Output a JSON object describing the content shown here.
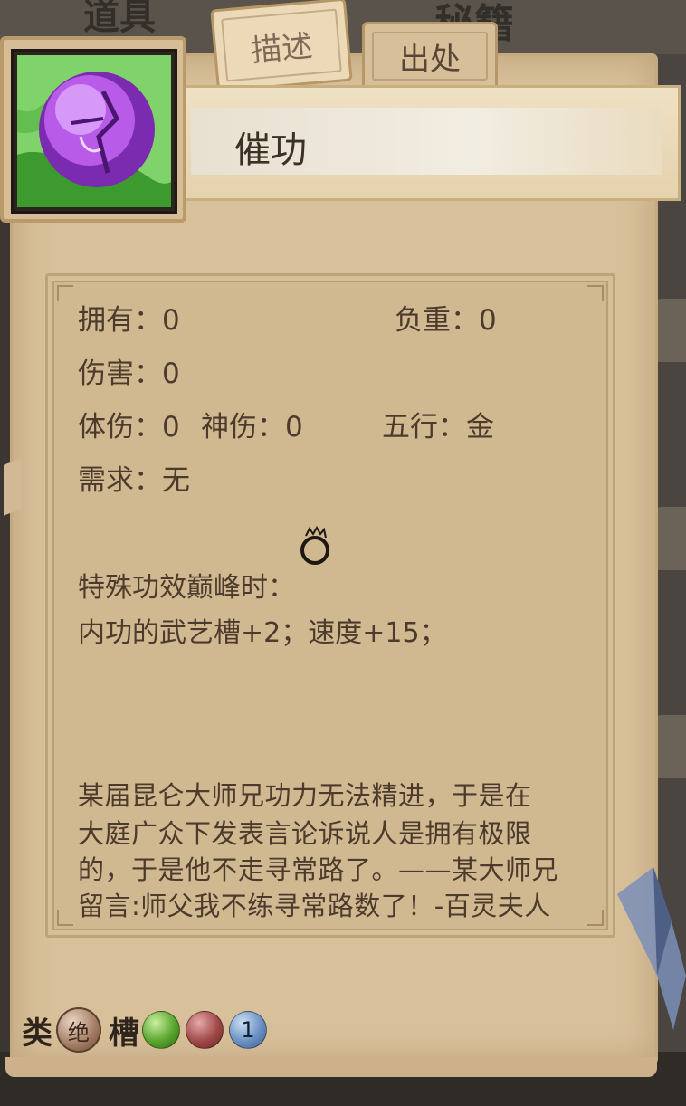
{
  "tabs": {
    "description": "描述",
    "source": "出处"
  },
  "item": {
    "name": "催功",
    "icon": "purple-martial-arts-orb-icon"
  },
  "stats": {
    "owned_label": "拥有：",
    "owned_value": "0",
    "weight_label": "负重：",
    "weight_value": "0",
    "damage_label": "伤害：",
    "damage_value": "0",
    "body_damage_label": "体伤：",
    "body_damage_value": "0",
    "spirit_damage_label": "神伤：",
    "spirit_damage_value": "0",
    "element_label": "五行：",
    "element_value": "金",
    "requirement_label": "需求：",
    "requirement_value": "无"
  },
  "special_effect": {
    "title": "特殊功效巅峰时：",
    "text": "内功的武艺槽+2；速度+15；"
  },
  "description_lines": [
    "某届昆仑大师兄功力无法精进，于是在",
    "大庭广众下发表言论诉说人是拥有极限",
    "的，于是他不走寻常路了。——某大师兄",
    "留言:师父我不练寻常路数了！-百灵夫人"
  ],
  "bottom": {
    "type_label": "类",
    "type_badge": "绝",
    "slot_label": "槽",
    "slot_number": "1"
  },
  "background_glyphs": [
    "道具",
    "秘籍"
  ],
  "colors": {
    "parchment": "#d8c09a",
    "text": "#4c3b2c",
    "icon_purple": "#9a3bd0",
    "icon_green": "#4caf3a"
  }
}
